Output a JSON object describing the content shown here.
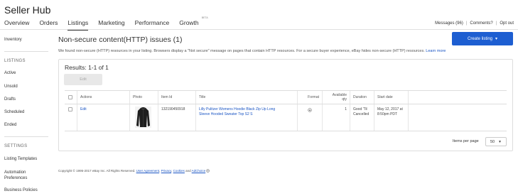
{
  "brand": "Seller Hub",
  "nav": {
    "tabs": [
      "Overview",
      "Orders",
      "Listings",
      "Marketing",
      "Performance",
      "Growth"
    ],
    "active": "Listings",
    "growth_badge": "BETA"
  },
  "top_links": {
    "messages": "Messages (96)",
    "comments": "Comments?",
    "optout": "Opt out",
    "separator": "|"
  },
  "sidebar": {
    "inventory": "Inventory",
    "listings_heading": "LISTINGS",
    "active": "Active",
    "unsold": "Unsold",
    "drafts": "Drafts",
    "scheduled": "Scheduled",
    "ended": "Ended",
    "settings_heading": "SETTINGS",
    "templates": "Listing Templates",
    "automation_1": "Automation",
    "automation_2": "Preferences",
    "business": "Business Policies"
  },
  "main": {
    "title": "Non-secure content(HTTP) issues (1)",
    "create_button": "Create listing",
    "info": "We found non-secure (HTTP) resources in your listing. Browsers display a \"Not secure\" message on pages that contain HTTP resources. For a secure buyer experience, eBay hides non-secure (HTTP) resources.",
    "learn_more": "Learn more",
    "results": "Results: 1-1 of 1",
    "edit_button": "Edit",
    "columns": {
      "actions": "Actions",
      "photo": "Photo",
      "item_id": "Item Id",
      "title": "Title",
      "format": "Format",
      "qty_1": "Available",
      "qty_2": "qty",
      "duration": "Duration",
      "start": "Start date"
    },
    "row": {
      "action": "Edit",
      "item_id": "132190450918",
      "title_1": "Lilly Pulitzer Womens Hoodie Black Zip Up Long",
      "title_2": "Sleeve Hooded Sweater Top S2 S",
      "qty": "1",
      "duration_1": "Good 'Til",
      "duration_2": "Cancelled",
      "start_1": "May 12, 2017 at",
      "start_2": "8:50pm PDT"
    },
    "items_per_page_label": "Items per page",
    "items_per_page_value": "50"
  },
  "footer": {
    "copyright": "Copyright © 1995-2017 eBay Inc. All Rights Reserved.",
    "user_agreement": "User Agreement",
    "privacy": "Privacy",
    "cookies": "Cookies",
    "and": "and",
    "adchoice": "AdChoice"
  },
  "colors": {
    "accent": "#1d5ed1",
    "link": "#1a55c4"
  }
}
